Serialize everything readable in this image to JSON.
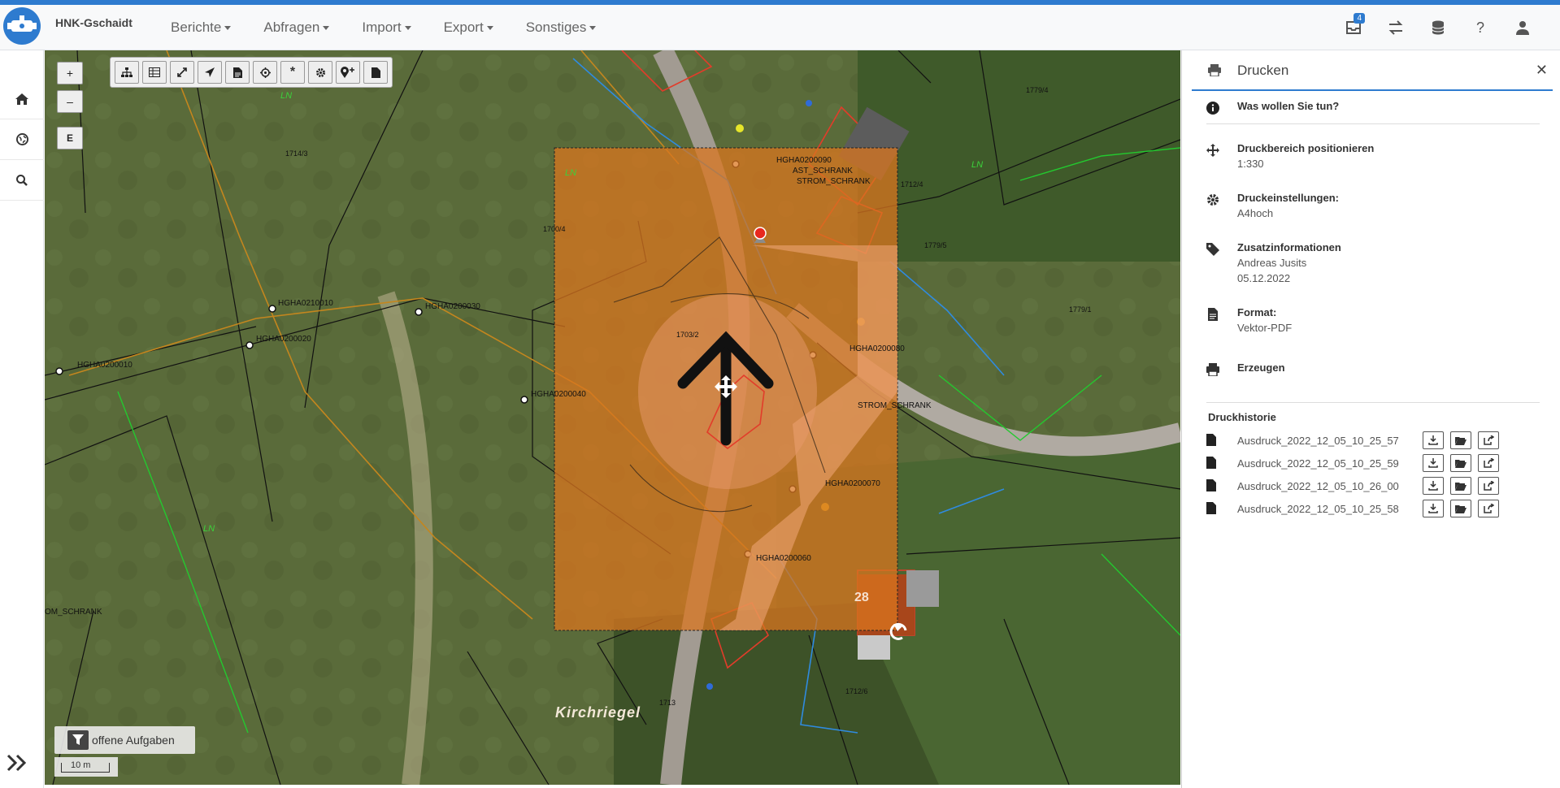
{
  "app": {
    "brand": "HNK-Gschaidt"
  },
  "menu": [
    {
      "label": "Berichte"
    },
    {
      "label": "Abfragen"
    },
    {
      "label": "Import"
    },
    {
      "label": "Export"
    },
    {
      "label": "Sonstiges"
    }
  ],
  "nav_right": {
    "inbox_count": "4",
    "help_label": "?"
  },
  "map": {
    "zoom_in": "+",
    "zoom_out": "–",
    "edit_label": "E",
    "tasks_label": "offene Aufgaben",
    "scale_label": "10 m",
    "labels": {
      "hgha10": "HGHA0210010",
      "hgha20": "HGHA0200020",
      "hgha30": "HGHA0200030",
      "hgha40": "HGHA0200040",
      "hgha_left": "HGHA0200010",
      "hgha60": "HGHA0200060",
      "hgha70": "HGHA0200070",
      "hgha80": "HGHA0200080",
      "hgha90": "HGHA0200090",
      "strom1": "STROM_SCHRANK",
      "strom2": "STROM_SCHRANK",
      "strom3": "OM_SCHRANK",
      "ast": "AST_SCHRANK",
      "street": "Kirchriegel",
      "p1714": "1714/3",
      "p1700": "1700/4",
      "p1712_4": "1712/4",
      "p1779_5": "1779/5",
      "p1779_4": "1779/4",
      "p1779_1": "1779/1",
      "p1703": "1703/2",
      "p1713": "1713",
      "p1712_6": "1712/6",
      "house28": "28",
      "ln": "LN"
    }
  },
  "panel": {
    "title": "Drucken",
    "question": "Was wollen Sie tun?",
    "steps": [
      {
        "title": "Druckbereich positionieren",
        "values": [
          "1:330"
        ]
      },
      {
        "title": "Druckeinstellungen:",
        "values": [
          "A4hoch"
        ]
      },
      {
        "title": "Zusatzinformationen",
        "values": [
          "Andreas Jusits",
          "05.12.2022"
        ]
      },
      {
        "title": "Format:",
        "values": [
          "Vektor-PDF"
        ]
      },
      {
        "title": "Erzeugen",
        "values": []
      }
    ],
    "history_title": "Druckhistorie",
    "history": [
      {
        "name": "Ausdruck_2022_12_05_10_25_57"
      },
      {
        "name": "Ausdruck_2022_12_05_10_25_59"
      },
      {
        "name": "Ausdruck_2022_12_05_10_26_00"
      },
      {
        "name": "Ausdruck_2022_12_05_10_25_58"
      }
    ]
  },
  "colors": {
    "accent": "#2e7bcf",
    "print_area": "#d9751f"
  }
}
